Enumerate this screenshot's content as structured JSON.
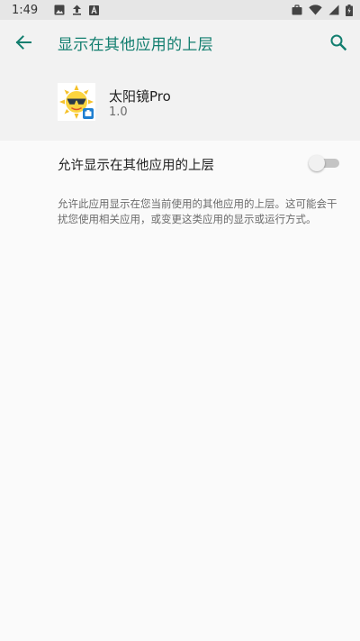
{
  "status_bar": {
    "time": "1:49",
    "left_icons": [
      "image-icon",
      "upload-icon",
      "font-icon"
    ],
    "right_icons": [
      "briefcase-icon",
      "wifi-icon",
      "signal-icon",
      "battery-icon"
    ]
  },
  "toolbar": {
    "title": "显示在其他应用的上层",
    "back_icon": "arrow-back-icon",
    "search_icon": "search-icon",
    "accent_color": "#127e6f"
  },
  "app": {
    "name": "太阳镜Pro",
    "version": "1.0",
    "icon": "sun-with-sunglasses-icon",
    "badge_icon": "work-profile-badge-icon"
  },
  "permission": {
    "label": "允许显示在其他应用的上层",
    "enabled": false,
    "description": "允许此应用显示在您当前使用的其他应用的上层。这可能会干扰您使用相关应用，或变更这类应用的显示或运行方式。"
  }
}
